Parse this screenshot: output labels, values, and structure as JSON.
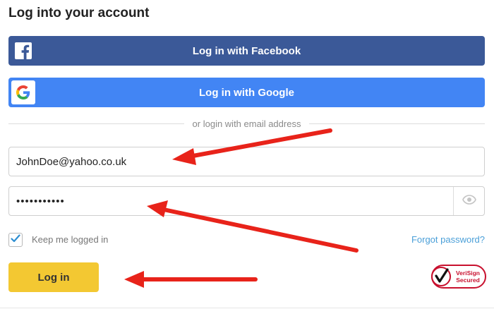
{
  "page": {
    "title": "Log into your account"
  },
  "social": {
    "facebook_label": "Log in with Facebook",
    "google_label": "Log in with Google",
    "facebook_color": "#3b5998",
    "google_color": "#4285f4"
  },
  "divider": {
    "text": "or login with email address"
  },
  "form": {
    "email_value": "JohnDoe@yahoo.co.uk",
    "password_value": "•••••••••••",
    "keep_logged_in_label": "Keep me logged in",
    "keep_logged_in_checked": true,
    "forgot_password_label": "Forgot password?",
    "login_label": "Log in",
    "login_color": "#f3c832",
    "link_color": "#4a9fd8"
  },
  "badge": {
    "line1": "VeriSign",
    "line2": "Secured"
  },
  "annotations": {
    "arrow_color": "#e8231a"
  }
}
